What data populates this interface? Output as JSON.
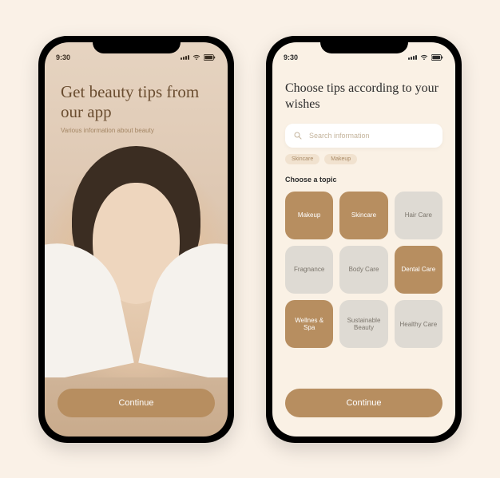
{
  "status": {
    "time": "9:30"
  },
  "left": {
    "title": "Get beauty tips from our app",
    "subtitle": "Various information about beauty",
    "cta": "Continue"
  },
  "right": {
    "title": "Choose tips according to your wishes",
    "search_placeholder": "Search information",
    "chips": [
      "Skincare",
      "Makeup"
    ],
    "section_label": "Choose a topic",
    "topics": [
      {
        "label": "Makeup",
        "selected": true
      },
      {
        "label": "Skincare",
        "selected": true
      },
      {
        "label": "Hair Care",
        "selected": false
      },
      {
        "label": "Fragnance",
        "selected": false
      },
      {
        "label": "Body Care",
        "selected": false
      },
      {
        "label": "Dental Care",
        "selected": true
      },
      {
        "label": "Wellnes & Spa",
        "selected": true
      },
      {
        "label": "Sustainable Beauty",
        "selected": false
      },
      {
        "label": "Healthy Care",
        "selected": false
      }
    ],
    "cta": "Continue"
  },
  "colors": {
    "accent": "#B78E60",
    "bg": "#FAF1E7",
    "screen2": "#FAF1E5"
  }
}
